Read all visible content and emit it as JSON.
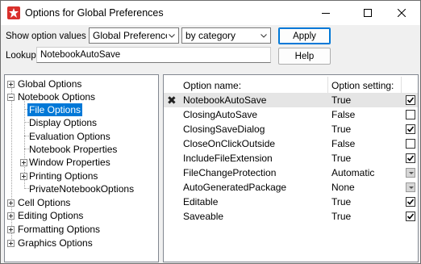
{
  "window": {
    "title": "Options for Global Preferences"
  },
  "toolbar": {
    "show_values_label": "Show option values",
    "scope_value": "Global Preferences",
    "view_value": "by category",
    "apply_label": "Apply",
    "lookup_label": "Lookup:",
    "lookup_value": "NotebookAutoSave",
    "help_label": "Help"
  },
  "tree": {
    "global_options": "Global Options",
    "notebook_options": "Notebook Options",
    "file_options": "File Options",
    "display_options": "Display Options",
    "evaluation_options": "Evaluation Options",
    "notebook_properties": "Notebook Properties",
    "window_properties": "Window Properties",
    "printing_options": "Printing Options",
    "private_notebook_options": "PrivateNotebookOptions",
    "cell_options": "Cell Options",
    "editing_options": "Editing Options",
    "formatting_options": "Formatting Options",
    "graphics_options": "Graphics Options"
  },
  "grid": {
    "col_name": "Option name:",
    "col_setting": "Option setting:",
    "rows": [
      {
        "name": "NotebookAutoSave",
        "value": "True",
        "checkbox": "checked",
        "marker": "✖"
      },
      {
        "name": "ClosingAutoSave",
        "value": "False",
        "checkbox": "unchecked"
      },
      {
        "name": "ClosingSaveDialog",
        "value": "True",
        "checkbox": "checked"
      },
      {
        "name": "CloseOnClickOutside",
        "value": "False",
        "checkbox": "unchecked"
      },
      {
        "name": "IncludeFileExtension",
        "value": "True",
        "checkbox": "checked"
      },
      {
        "name": "FileChangeProtection",
        "value": "Automatic",
        "checkbox": "dropdown"
      },
      {
        "name": "AutoGeneratedPackage",
        "value": "None",
        "checkbox": "dropdown"
      },
      {
        "name": "Editable",
        "value": "True",
        "checkbox": "checked"
      },
      {
        "name": "Saveable",
        "value": "True",
        "checkbox": "checked"
      }
    ]
  },
  "colors": {
    "selection": "#0078d7",
    "app_icon": "#d9302c",
    "selected_row": "#e5e5e5"
  },
  "icons": {
    "app": "mathematica-star-icon",
    "minimize": "minimize-icon",
    "maximize": "maximize-icon",
    "close": "close-icon",
    "dropdown": "chevron-down-icon",
    "expander": "plus-box-icon",
    "checkbox": "checkmark-icon"
  }
}
